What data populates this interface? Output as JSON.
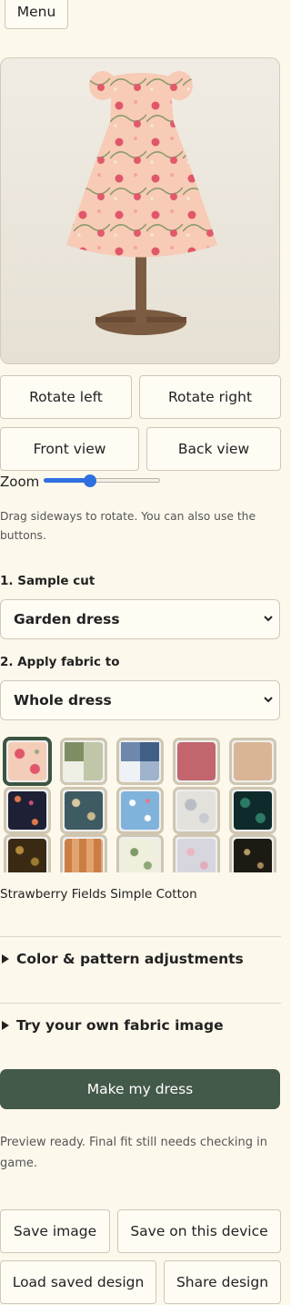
{
  "menu_label": "Menu",
  "view_controls": {
    "rotate_left": "Rotate left",
    "rotate_right": "Rotate right",
    "front_view": "Front view",
    "back_view": "Back view",
    "zoom_label": "Zoom",
    "zoom_level": 0.4,
    "hint": "Drag sideways to rotate. You can also use the buttons."
  },
  "step1": {
    "label": "1. Sample cut",
    "selected": "Garden dress"
  },
  "step2": {
    "label": "2. Apply fabric to",
    "selected": "Whole dress"
  },
  "fabrics": {
    "selected_name": "Strawberry Fields Simple Cotton",
    "swatches": [
      "strawberry",
      "sage-check",
      "blue-check",
      "rose-solid",
      "tan-solid",
      "dark-floral",
      "teal-floral",
      "sky-floral",
      "grey-floral",
      "green-damask",
      "gold-paisley",
      "orange-plaid",
      "ivory-vine",
      "lilac-floral",
      "black-floral"
    ]
  },
  "sections": {
    "adjustments": "Color & pattern adjustments",
    "own_fabric": "Try your own fabric image"
  },
  "make_button": "Make my dress",
  "status": "Preview ready. Final fit still needs checking in game.",
  "actions": {
    "save_image": "Save image",
    "save_device": "Save on this device",
    "load_saved": "Load saved design",
    "share": "Share design"
  },
  "colors": {
    "background": "#fdf8ec",
    "primary_button": "#43594a",
    "swatch_border": "#cfc6b1",
    "selected_border": "#3c5542"
  }
}
